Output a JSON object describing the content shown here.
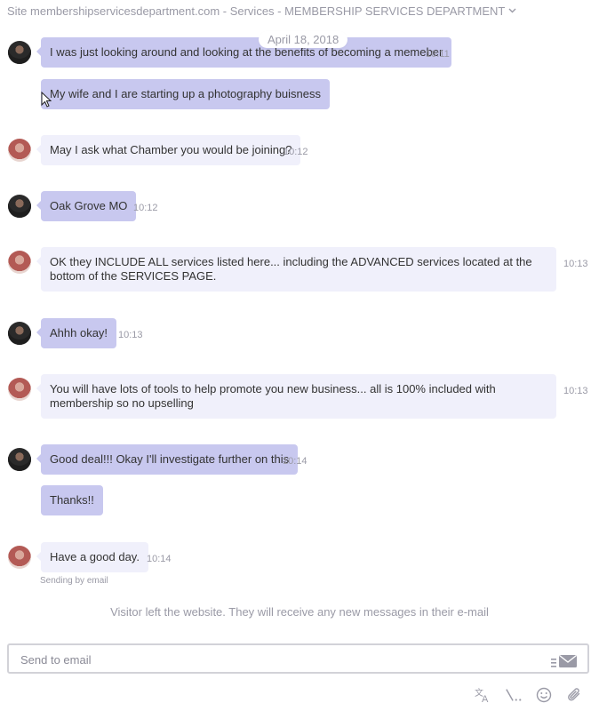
{
  "header": {
    "title": "Site membershipservicesdepartment.com - Services - MEMBERSHIP SERVICES DEPARTMENT",
    "chevron_icon": "chevron-down-icon"
  },
  "date_label": "April 18, 2018",
  "messages": [
    {
      "sender": "visitor",
      "text": "I was just looking around and looking at the benefits of becoming a memeber",
      "time": "10:11"
    },
    {
      "sender": "visitor",
      "text": "My wife and I are starting up a photography buisness",
      "time": ""
    },
    {
      "sender": "agent",
      "text": "May I ask what Chamber you would be joining?",
      "time": "10:12"
    },
    {
      "sender": "visitor",
      "text": "Oak Grove MO",
      "time": "10:12"
    },
    {
      "sender": "agent",
      "text": "OK they INCLUDE ALL services listed here... including the ADVANCED services located at the bottom of the SERVICES PAGE.",
      "time": "10:13"
    },
    {
      "sender": "visitor",
      "text": "Ahhh okay!",
      "time": "10:13"
    },
    {
      "sender": "agent",
      "text": "You will have lots of tools to help promote you new business... all is 100% included with membership so no upselling",
      "time": "10:13"
    },
    {
      "sender": "visitor",
      "text": "Good deal!!! Okay I'll investigate further on this",
      "time": "10:14"
    },
    {
      "sender": "visitor",
      "text": "Thanks!!",
      "time": ""
    },
    {
      "sender": "agent",
      "text": "Have a good day.",
      "time": "10:14"
    }
  ],
  "sending_note": "Sending by email",
  "visitor_left_note": "Visitor left the website. They will receive any new messages in their e-mail",
  "input": {
    "placeholder": "Send to email",
    "value": ""
  },
  "toolbar_icons": [
    "translate-icon",
    "slash-command-icon",
    "emoji-icon",
    "attachment-icon"
  ],
  "colors": {
    "visitor_bubble": "#c8c8ef",
    "agent_bubble": "#f0f0fb",
    "muted_text": "#9a9aa6"
  }
}
